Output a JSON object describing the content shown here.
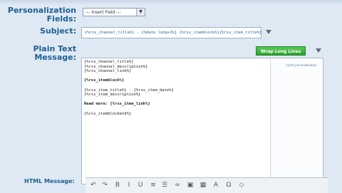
{
  "form": {
    "personalization_label": "Personalization Fields:",
    "personalization_select": "--- Insert Field ---",
    "subject_label": "Subject:",
    "subject_value": "{%rss_channel_title%} - {%date long+1%} {%rss_itemblock%}{%rss_item_title%}",
    "plain_text_label": "Plain Text Message:",
    "wrap_button": "Wrap Long Lines",
    "html_label": "HTML Message:"
  },
  "plain_text_lines": [
    "{%rss_channel_title%}",
    "{%rss_channel_description%}",
    "{%rss_channel_link%}",
    "",
    "{%rss_itemblock%}",
    "",
    "{%rss_item_title%} - {%rss_item_date%}",
    "{%rss_item_description%}",
    "",
    "Read more: {%rss_item_link%}",
    "",
    "{%rss_itemblockend%}"
  ],
  "side_panel_link": "insert personalization",
  "colors": {
    "label": "#1f5f93",
    "button_green": "#2ea32f",
    "background": "#dfe9f3"
  }
}
